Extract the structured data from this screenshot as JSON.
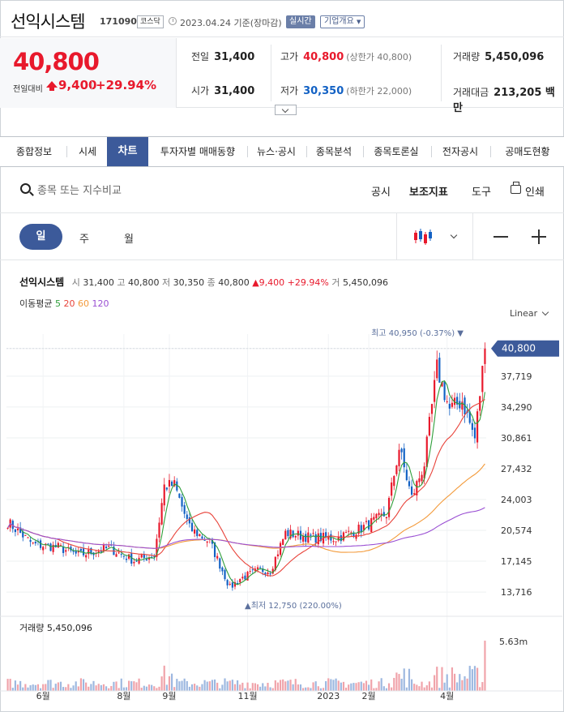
{
  "header": {
    "stock_name": "선익시스템",
    "code": "171090",
    "market": "코스닥",
    "date": "2023.04.24 기준(장마감)",
    "live_label": "실시간",
    "company_info": "기업개요"
  },
  "quote": {
    "price": "40,800",
    "change_label": "전일대비",
    "change": "9,400",
    "change_pct": "+29.94%",
    "prev_close_label": "전일",
    "prev_close": "31,400",
    "high_label": "고가",
    "high": "40,800",
    "upper_limit": "(상한가 40,800)",
    "volume_label": "거래량",
    "volume": "5,450,096",
    "open_label": "시가",
    "open": "31,400",
    "low_label": "저가",
    "low": "30,350",
    "lower_limit": "(하한가 22,000)",
    "amount_label": "거래대금",
    "amount": "213,205 백만"
  },
  "tabs": [
    "종합정보",
    "시세",
    "차트",
    "투자자별 매매동향",
    "뉴스·공시",
    "종목분석",
    "종목토론실",
    "전자공시",
    "공매도현황"
  ],
  "active_tab": "차트",
  "toolbar": {
    "search_placeholder": "종목 또는 지수비교",
    "disclosure": "공시",
    "indicators": "보조지표",
    "tools": "도구",
    "print": "인쇄"
  },
  "periods": {
    "day": "일",
    "week": "주",
    "month": "월"
  },
  "legend": {
    "name": "선익시스템",
    "open_k": "시",
    "open": "31,400",
    "high_k": "고",
    "high": "40,800",
    "low_k": "저",
    "low": "30,350",
    "close_k": "종",
    "close": "40,800",
    "change": "▲9,400",
    "pct": "+29.94%",
    "vol_k": "거",
    "vol": "5,450,096"
  },
  "ma_legend": {
    "label": "이동평균",
    "ma5": "5",
    "ma20": "20",
    "ma60": "60",
    "ma120": "120"
  },
  "scale_label": "Linear",
  "colors": {
    "up": "#e8192c",
    "down": "#1261c4",
    "accent": "#3c5a9a",
    "ma5": "#2f9e3a",
    "ma20": "#e8433a",
    "ma60": "#f39a3a",
    "ma120": "#9a4fd3"
  },
  "chart_data": {
    "type": "candlestick",
    "y_ticks": [
      40800,
      37719,
      34290,
      30861,
      27432,
      24003,
      20574,
      17145,
      13716
    ],
    "y_tick_labels": [
      "40,800",
      "37,719",
      "34,290",
      "30,861",
      "27,432",
      "24,003",
      "20,574",
      "17,145",
      "13,716"
    ],
    "ylim": [
      12100,
      42400
    ],
    "current_price_label": "40,800",
    "max_annotation": "최고 40,950 (-0.37%) ▼",
    "min_annotation": "▲최저 12,750 (220.00%)",
    "x_labels": [
      "6월",
      "8월",
      "9월",
      "11월",
      "2023",
      "2월",
      "4월"
    ],
    "x_label_positions": [
      14,
      46,
      64,
      95,
      127,
      143,
      174
    ],
    "n_days": 190,
    "close_anchors": [
      [
        0,
        21500
      ],
      [
        10,
        19000
      ],
      [
        20,
        18700
      ],
      [
        28,
        17800
      ],
      [
        40,
        18600
      ],
      [
        50,
        17200
      ],
      [
        58,
        17800
      ],
      [
        62,
        25500
      ],
      [
        66,
        25600
      ],
      [
        72,
        20800
      ],
      [
        80,
        19300
      ],
      [
        88,
        14200
      ],
      [
        92,
        15200
      ],
      [
        100,
        16200
      ],
      [
        104,
        16100
      ],
      [
        110,
        20300
      ],
      [
        120,
        19800
      ],
      [
        130,
        19700
      ],
      [
        140,
        20800
      ],
      [
        150,
        22400
      ],
      [
        155,
        29700
      ],
      [
        160,
        24200
      ],
      [
        165,
        28000
      ],
      [
        170,
        38600
      ],
      [
        175,
        34000
      ],
      [
        180,
        35000
      ],
      [
        185,
        30800
      ],
      [
        189,
        40800
      ]
    ],
    "volume_label": "거래량 5,450,096",
    "volume_tick": "5.63m",
    "volume_max": 5630000
  }
}
